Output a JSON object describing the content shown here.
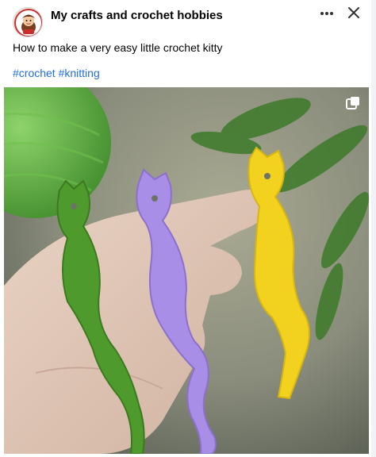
{
  "post": {
    "page_name": "My crafts and crochet hobbies",
    "caption": "How to make a very easy little crochet kitty",
    "hashtags": [
      "#crochet",
      "#knitting"
    ]
  },
  "icons": {
    "avatar": "profile-avatar",
    "more": "more-options-icon",
    "close": "close-icon",
    "expand": "expand-media-icon"
  },
  "colors": {
    "link": "#216fdb",
    "text": "#050505",
    "kitty_green": "#4e9a2c",
    "kitty_purple": "#a98ee8",
    "kitty_yellow": "#f2d21e"
  }
}
